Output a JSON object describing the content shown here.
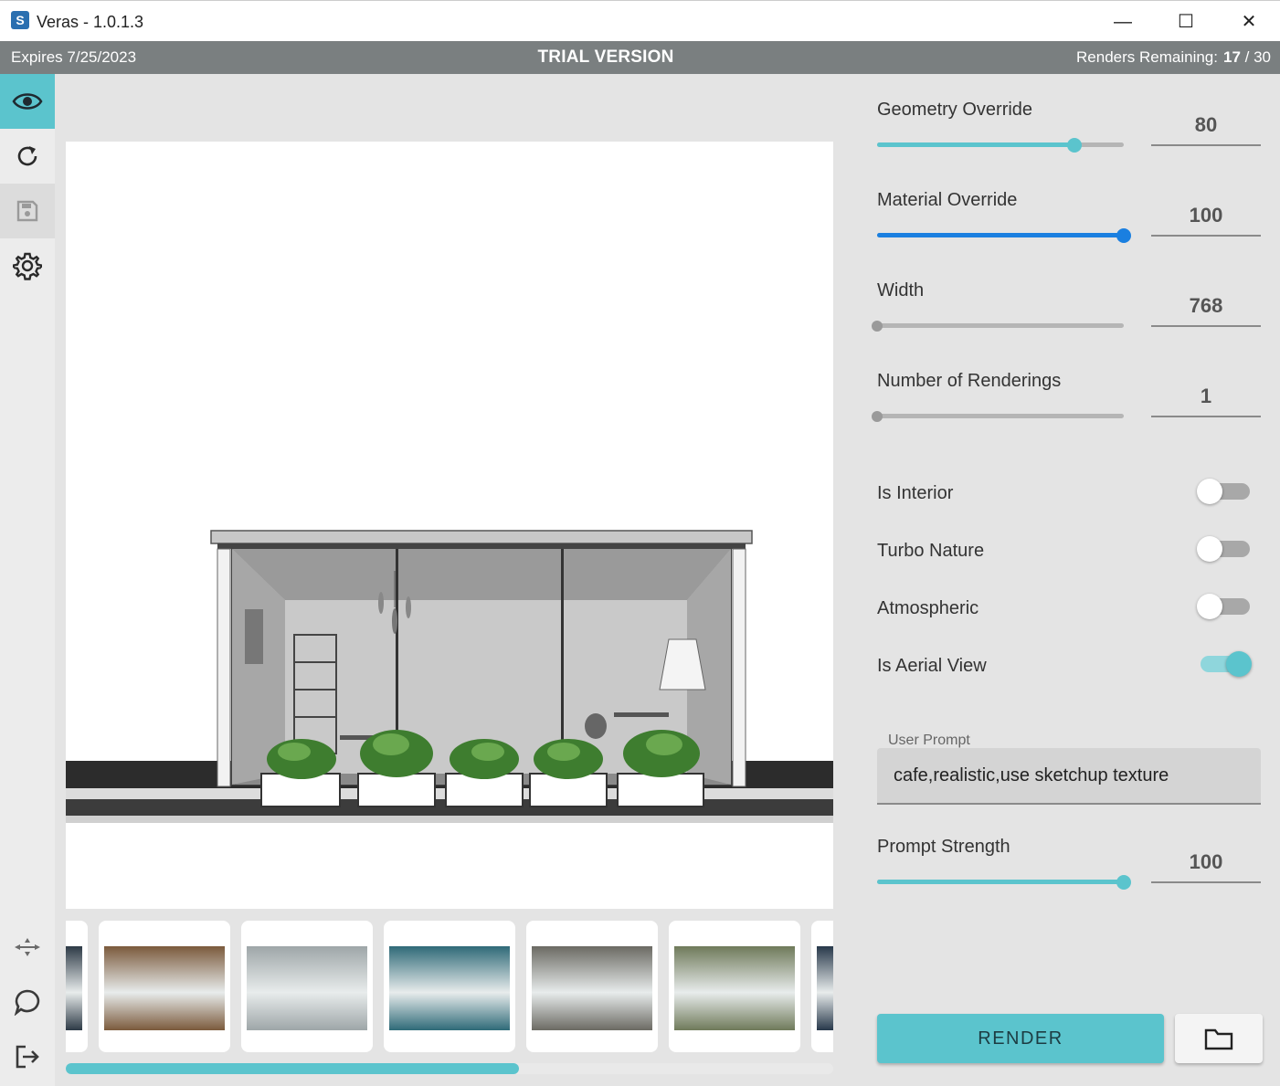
{
  "window": {
    "title": "Veras - 1.0.1.3",
    "minimize_glyph": "—",
    "maximize_glyph": "☐",
    "close_glyph": "✕"
  },
  "trial": {
    "expires": "Expires 7/25/2023",
    "title": "TRIAL VERSION",
    "remaining_label": "Renders Remaining:",
    "remaining_used": "17",
    "remaining_total": "/ 30"
  },
  "sidebar": {
    "top_icons": [
      "eye-icon",
      "refresh-icon",
      "save-icon",
      "gear-icon"
    ],
    "bottom_icons": [
      "collapse-icon",
      "chat-icon",
      "logout-icon"
    ]
  },
  "sliders": {
    "geometry": {
      "label": "Geometry Override",
      "value": "80",
      "fraction": 0.8,
      "color": "#5bc4cd"
    },
    "material": {
      "label": "Material Override",
      "value": "100",
      "fraction": 1.0,
      "color": "#1a7fe0"
    },
    "width": {
      "label": "Width",
      "value": "768",
      "fraction": 0
    },
    "renderings": {
      "label": "Number of Renderings",
      "value": "1",
      "fraction": 0
    },
    "prompt_strength": {
      "label": "Prompt Strength",
      "value": "100",
      "fraction": 1.0,
      "color": "#5bc4cd"
    }
  },
  "toggles": {
    "is_interior": {
      "label": "Is Interior",
      "on": false
    },
    "turbo_nature": {
      "label": "Turbo Nature",
      "on": false
    },
    "atmospheric": {
      "label": "Atmospheric",
      "on": false
    },
    "aerial_view": {
      "label": "Is Aerial View",
      "on": true
    }
  },
  "prompt": {
    "caption": "User Prompt",
    "value": "cafe,realistic,use sketchup texture"
  },
  "actions": {
    "render_label": "RENDER",
    "folder_icon": "folder-icon"
  },
  "gallery": {
    "scroll_fraction": 0.59,
    "thumbnails": [
      {
        "tone": "#2d3a46"
      },
      {
        "tone": "#7b5a3c"
      },
      {
        "tone": "#9ea6a8"
      },
      {
        "tone": "#2f6a78"
      },
      {
        "tone": "#6b6a63"
      },
      {
        "tone": "#6f7a5a"
      },
      {
        "tone": "#27384a"
      }
    ]
  },
  "colors": {
    "accent": "#5bc4cd",
    "trial_bar": "#7a7f80",
    "material_slider": "#1a7fe0"
  }
}
